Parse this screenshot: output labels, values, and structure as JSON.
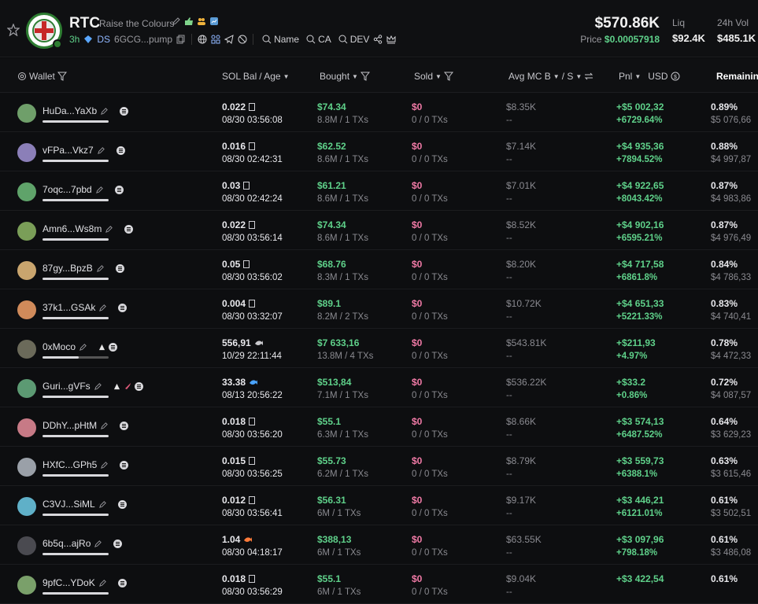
{
  "token": {
    "symbol": "RTC",
    "name": "Raise the Colours",
    "age": "3h",
    "ds_label": "DS",
    "address": "6GCG...pump",
    "links": {
      "name": "Name",
      "ca": "CA",
      "dev": "DEV"
    }
  },
  "stats": {
    "market_cap": "$570.86K",
    "price_label": "Price",
    "price": "$0.00057918",
    "liq_label": "Liq",
    "liq_value": "$92.4K",
    "vol_label": "24h Vol",
    "vol_value": "$485.1K"
  },
  "columns": {
    "wallet": "Wallet",
    "sol_bal": "SOL Bal",
    "age": "/ Age",
    "bought": "Bought",
    "sold": "Sold",
    "avg_mc": "Avg MC B",
    "avg_mc_s": "/ S",
    "pnl": "Pnl",
    "usd": "USD",
    "remaining": "Remaining"
  },
  "rows": [
    {
      "wallet": "HuDa...YaXb",
      "avatar": "#6f9f6a",
      "sol": "0.022",
      "time": "08/30 03:56:08",
      "bought": "$74.34",
      "bought_sub": "8.8M / 1 TXs",
      "sold": "$0",
      "sold_sub": "0 / 0 TXs",
      "avg": "$8.35K",
      "avg_sub": "--",
      "pnl": "+$5 002,32",
      "pnl_pct": "+6729.64%",
      "rem_pct": "0.89%",
      "rem_usd": "$5 076,66",
      "extra": ""
    },
    {
      "wallet": "vFPa...Vkz7",
      "avatar": "#8b7fb8",
      "sol": "0.016",
      "time": "08/30 02:42:31",
      "bought": "$62.52",
      "bought_sub": "8.6M / 1 TXs",
      "sold": "$0",
      "sold_sub": "0 / 0 TXs",
      "avg": "$7.14K",
      "avg_sub": "--",
      "pnl": "+$4 935,36",
      "pnl_pct": "+7894.52%",
      "rem_pct": "0.88%",
      "rem_usd": "$4 997,87",
      "extra": ""
    },
    {
      "wallet": "7oqc...7pbd",
      "avatar": "#5fa36a",
      "sol": "0.03",
      "time": "08/30 02:42:24",
      "bought": "$61.21",
      "bought_sub": "8.6M / 1 TXs",
      "sold": "$0",
      "sold_sub": "0 / 0 TXs",
      "avg": "$7.01K",
      "avg_sub": "--",
      "pnl": "+$4 922,65",
      "pnl_pct": "+8043.42%",
      "rem_pct": "0.87%",
      "rem_usd": "$4 983,86",
      "extra": ""
    },
    {
      "wallet": "Amn6...Ws8m",
      "avatar": "#7a9e58",
      "sol": "0.022",
      "time": "08/30 03:56:14",
      "bought": "$74.34",
      "bought_sub": "8.6M / 1 TXs",
      "sold": "$0",
      "sold_sub": "0 / 0 TXs",
      "avg": "$8.52K",
      "avg_sub": "--",
      "pnl": "+$4 902,16",
      "pnl_pct": "+6595.21%",
      "rem_pct": "0.87%",
      "rem_usd": "$4 976,49",
      "extra": ""
    },
    {
      "wallet": "87gy...BpzB",
      "avatar": "#c9a56e",
      "sol": "0.05",
      "time": "08/30 03:56:02",
      "bought": "$68.76",
      "bought_sub": "8.3M / 1 TXs",
      "sold": "$0",
      "sold_sub": "0 / 0 TXs",
      "avg": "$8.20K",
      "avg_sub": "--",
      "pnl": "+$4 717,58",
      "pnl_pct": "+6861.8%",
      "rem_pct": "0.84%",
      "rem_usd": "$4 786,33",
      "extra": ""
    },
    {
      "wallet": "37k1...GSAk",
      "avatar": "#d08a5a",
      "sol": "0.004",
      "time": "08/30 03:32:07",
      "bought": "$89.1",
      "bought_sub": "8.2M / 2 TXs",
      "sold": "$0",
      "sold_sub": "0 / 0 TXs",
      "avg": "$10.72K",
      "avg_sub": "--",
      "pnl": "+$4 651,33",
      "pnl_pct": "+5221.33%",
      "rem_pct": "0.83%",
      "rem_usd": "$4 740,41",
      "extra": ""
    },
    {
      "wallet": "0xMoco",
      "avatar": "#6b6a5a",
      "sol": "556,91",
      "time": "10/29 22:11:44",
      "bought": "$7 633,16",
      "bought_sub": "13.8M / 4 TXs",
      "sold": "$0",
      "sold_sub": "0 / 0 TXs",
      "avg": "$543.81K",
      "avg_sub": "--",
      "pnl": "+$211,93",
      "pnl_pct": "+4.97%",
      "rem_pct": "0.78%",
      "rem_usd": "$4 472,33",
      "extra": "tri"
    },
    {
      "wallet": "Guri...gVFs",
      "avatar": "#5c9a73",
      "sol": "33.38",
      "time": "08/13 20:56:22",
      "bought": "$513,84",
      "bought_sub": "7.1M / 1 TXs",
      "sold": "$0",
      "sold_sub": "0 / 0 TXs",
      "avg": "$536.22K",
      "avg_sub": "--",
      "pnl": "+$33.2",
      "pnl_pct": "+0.86%",
      "rem_pct": "0.72%",
      "rem_usd": "$4 087,57",
      "extra": "tri-red"
    },
    {
      "wallet": "DDhY...pHtM",
      "avatar": "#c77a86",
      "sol": "0.018",
      "time": "08/30 03:56:20",
      "bought": "$55.1",
      "bought_sub": "6.3M / 1 TXs",
      "sold": "$0",
      "sold_sub": "0 / 0 TXs",
      "avg": "$8.66K",
      "avg_sub": "--",
      "pnl": "+$3 574,13",
      "pnl_pct": "+6487.52%",
      "rem_pct": "0.64%",
      "rem_usd": "$3 629,23",
      "extra": ""
    },
    {
      "wallet": "HXfC...GPh5",
      "avatar": "#9aa0a8",
      "sol": "0.015",
      "time": "08/30 03:56:25",
      "bought": "$55.73",
      "bought_sub": "6.2M / 1 TXs",
      "sold": "$0",
      "sold_sub": "0 / 0 TXs",
      "avg": "$8.79K",
      "avg_sub": "--",
      "pnl": "+$3 559,73",
      "pnl_pct": "+6388.1%",
      "rem_pct": "0.63%",
      "rem_usd": "$3 615,46",
      "extra": ""
    },
    {
      "wallet": "C3VJ...SiML",
      "avatar": "#5fb0c8",
      "sol": "0.012",
      "time": "08/30 03:56:41",
      "bought": "$56.31",
      "bought_sub": "6M / 1 TXs",
      "sold": "$0",
      "sold_sub": "0 / 0 TXs",
      "avg": "$9.17K",
      "avg_sub": "--",
      "pnl": "+$3 446,21",
      "pnl_pct": "+6121.01%",
      "rem_pct": "0.61%",
      "rem_usd": "$3 502,51",
      "extra": ""
    },
    {
      "wallet": "6b5q...ajRo",
      "avatar": "#4a4a50",
      "sol": "1.04",
      "time": "08/30 04:18:17",
      "bought": "$388,13",
      "bought_sub": "6M / 1 TXs",
      "sold": "$0",
      "sold_sub": "0 / 0 TXs",
      "avg": "$63.55K",
      "avg_sub": "--",
      "pnl": "+$3 097,96",
      "pnl_pct": "+798.18%",
      "rem_pct": "0.61%",
      "rem_usd": "$3 486,08",
      "extra": ""
    },
    {
      "wallet": "9pfC...YDoK",
      "avatar": "#7aa06a",
      "sol": "0.018",
      "time": "08/30 03:56:29",
      "bought": "$55.1",
      "bought_sub": "6M / 1 TXs",
      "sold": "$0",
      "sold_sub": "0 / 0 TXs",
      "avg": "$9.04K",
      "avg_sub": "--",
      "pnl": "+$3 422,54",
      "pnl_pct": "",
      "rem_pct": "0.61%",
      "rem_usd": "",
      "extra": ""
    }
  ]
}
